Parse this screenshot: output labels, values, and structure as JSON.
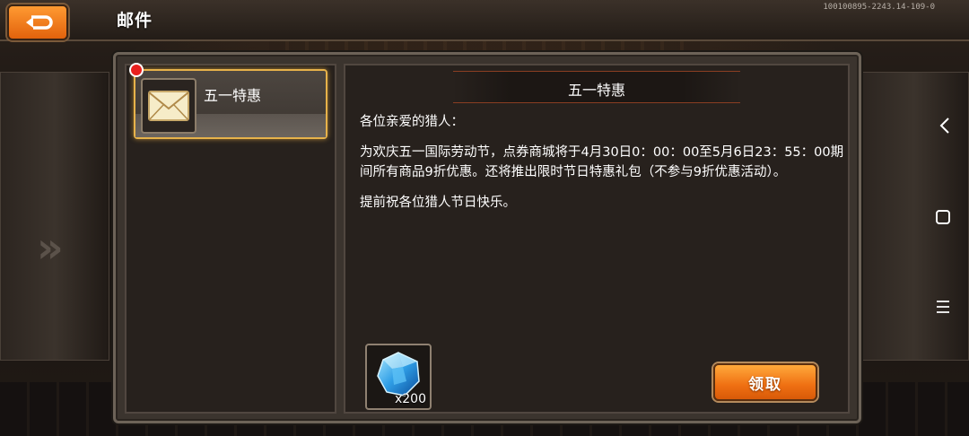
{
  "header": {
    "title": "邮件",
    "version": "100100895-2243.14-109-0"
  },
  "mail_list": [
    {
      "label": "五一特惠",
      "unread": true
    }
  ],
  "message": {
    "title": "五一特惠",
    "greeting": "各位亲爱的猎人：",
    "paragraph": "为欢庆五一国际劳动节，点券商城将于4月30日0：00：00至5月6日23：55：00期间所有商品9折优惠。还将推出限时节日特惠礼包（不参与9折优惠活动）。",
    "closing": "提前祝各位猎人节日快乐。"
  },
  "reward": {
    "icon": "blue-gem-icon",
    "count": "x200"
  },
  "actions": {
    "claim_label": "领取"
  },
  "colors": {
    "accent_orange": "#ef6f12",
    "highlight_gold": "#e7b24a",
    "unread_red": "#e8201e"
  }
}
